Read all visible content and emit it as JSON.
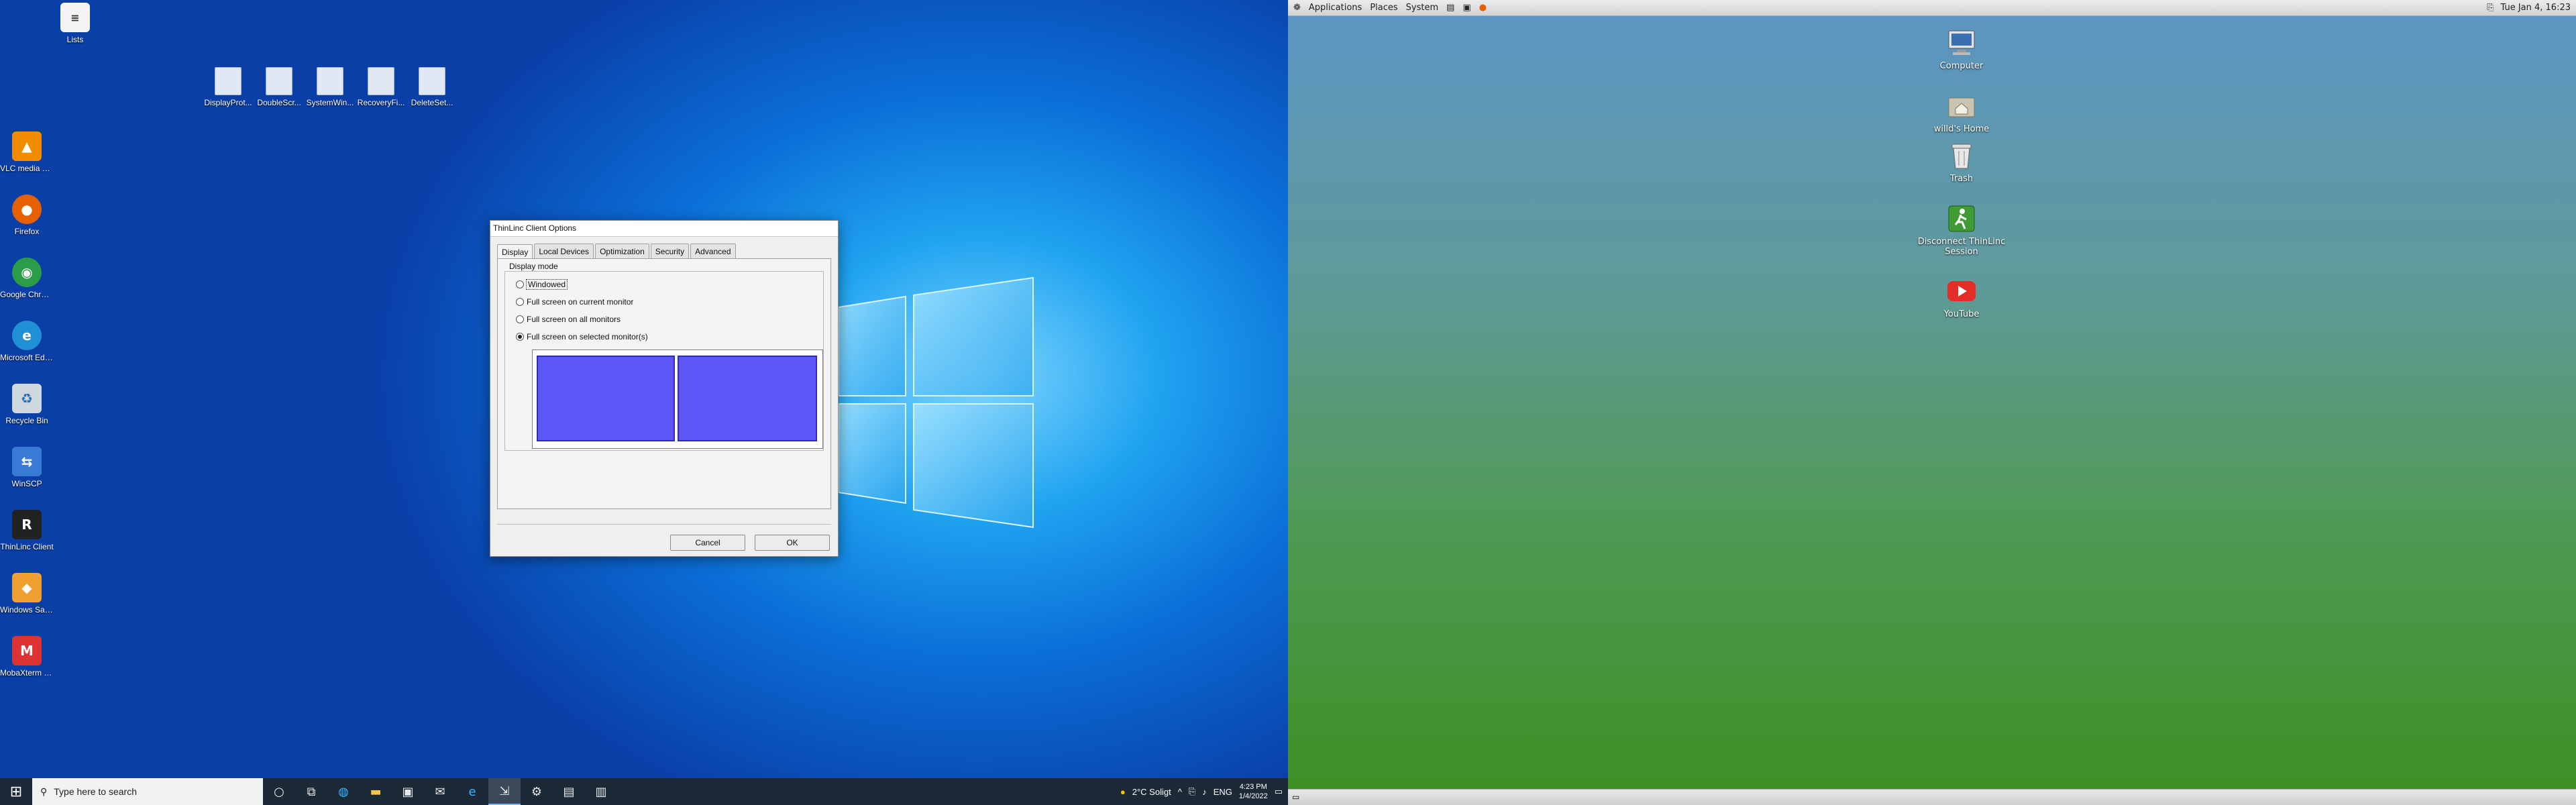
{
  "windows": {
    "desktop_icons_top": [
      {
        "name": "desktop-icon-lists",
        "label": "Lists"
      }
    ],
    "desktop_tiles": [
      {
        "label": "DisplayProt..."
      },
      {
        "label": "DoubleScr..."
      },
      {
        "label": "SystemWin..."
      },
      {
        "label": "RecoveryFi..."
      },
      {
        "label": "DeleteSet..."
      }
    ],
    "desktop_icons_left": [
      {
        "label": "VLC media player",
        "color": "#f28c00",
        "glyph": "▲"
      },
      {
        "label": "Firefox",
        "color": "#e66000",
        "glyph": "●"
      },
      {
        "label": "Google Chrome",
        "color": "#2b9c48",
        "glyph": "◉"
      },
      {
        "label": "Microsoft Edge",
        "color": "#1f8fd6",
        "glyph": "e"
      },
      {
        "label": "Recycle Bin",
        "color": "#cfd8e0",
        "glyph": "♻"
      },
      {
        "label": "WinSCP",
        "color": "#3a7bd5",
        "glyph": "⇆"
      },
      {
        "label": "ThinLinc Client",
        "color": "#222",
        "glyph": "R"
      },
      {
        "label": "Windows Sandbox",
        "color": "#f0a030",
        "glyph": "◆"
      },
      {
        "label": "MobaXterm Personal",
        "color": "#d33",
        "glyph": "M"
      }
    ],
    "taskbar": {
      "search_placeholder": "Type here to search",
      "weather": "2°C  Soligt",
      "lang": "ENG",
      "time": "4:23 PM",
      "date": "1/4/2022"
    }
  },
  "dialog": {
    "title": "ThinLinc Client Options",
    "tabs": [
      "Display",
      "Local Devices",
      "Optimization",
      "Security",
      "Advanced"
    ],
    "active_tab": "Display",
    "group_label": "Display mode",
    "options": [
      {
        "label": "Windowed",
        "selected": false
      },
      {
        "label": "Full screen on current monitor",
        "selected": false
      },
      {
        "label": "Full screen on all monitors",
        "selected": false
      },
      {
        "label": "Full screen on selected monitor(s)",
        "selected": true
      }
    ],
    "buttons": {
      "cancel": "Cancel",
      "ok": "OK"
    },
    "monitor_color": "#5b56f5"
  },
  "linux": {
    "panel": {
      "menus": [
        "Applications",
        "Places",
        "System"
      ],
      "clock": "Tue Jan  4, 16:23"
    },
    "desktop_icons": [
      {
        "label": "Computer",
        "glyph": "🖥"
      },
      {
        "label": "willd's Home",
        "glyph": "⌂"
      },
      {
        "label": "Trash",
        "glyph": "🗑"
      },
      {
        "label": "Disconnect ThinLinc Session",
        "glyph": "⇥"
      },
      {
        "label": "YouTube",
        "glyph": "▶"
      }
    ]
  }
}
